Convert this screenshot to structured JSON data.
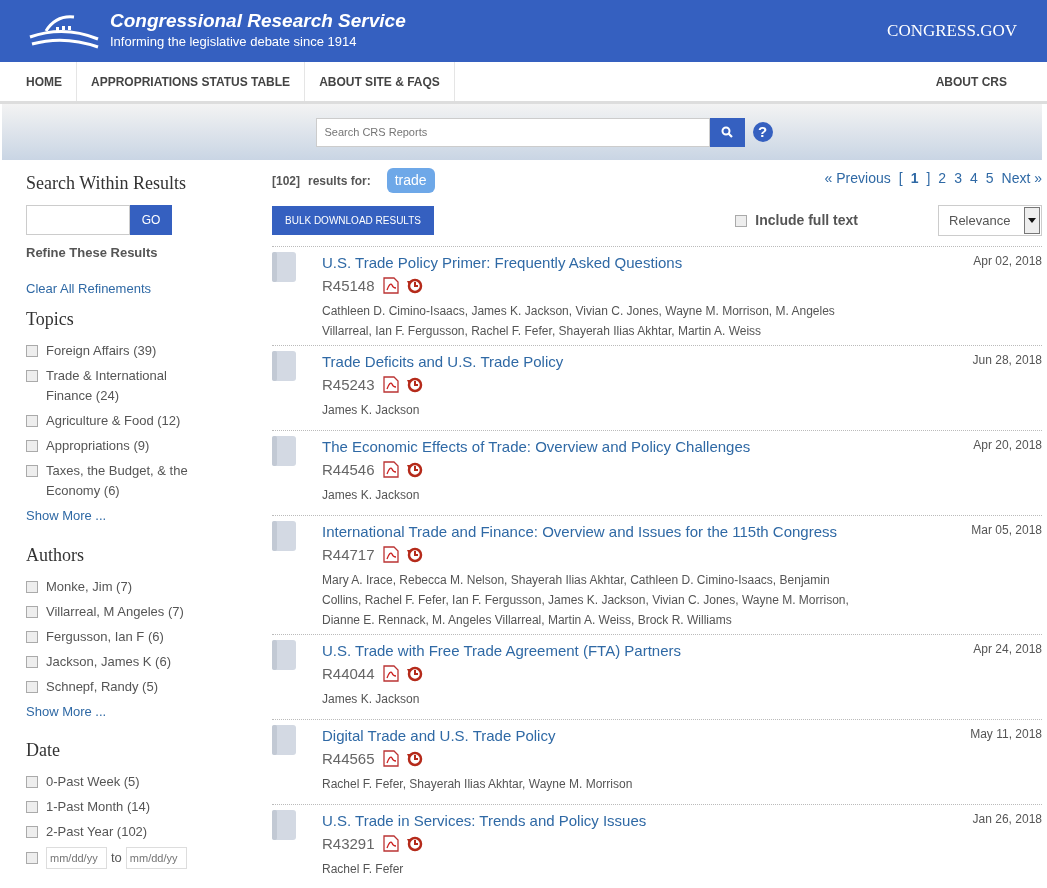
{
  "header": {
    "title": "Congressional Research Service",
    "tagline": "Informing the legislative debate since 1914",
    "partner": "CONGRESS.GOV"
  },
  "nav": {
    "left": [
      "HOME",
      "APPROPRIATIONS STATUS TABLE",
      "ABOUT SITE & FAQS"
    ],
    "right": [
      "ABOUT CRS"
    ]
  },
  "search": {
    "placeholder": "Search CRS Reports",
    "help": "?"
  },
  "sidebar": {
    "title": "Search Within Results",
    "go": "GO",
    "refine": "Refine These Results",
    "clear": "Clear All Refinements",
    "groups": [
      {
        "title": "Topics",
        "items": [
          {
            "label": "Foreign Affairs (39)",
            "checked": false
          },
          {
            "label": "Trade & International Finance (24)",
            "checked": false
          },
          {
            "label": "Agriculture & Food (12)",
            "checked": false
          },
          {
            "label": "Appropriations (9)",
            "checked": false
          },
          {
            "label": "Taxes, the Budget, & the Economy (6)",
            "checked": false
          }
        ],
        "more": "Show More ..."
      },
      {
        "title": "Authors",
        "items": [
          {
            "label": "Monke, Jim (7)",
            "checked": false
          },
          {
            "label": "Villarreal, M Angeles (7)",
            "checked": false
          },
          {
            "label": "Fergusson, Ian F (6)",
            "checked": false
          },
          {
            "label": "Jackson, James K (6)",
            "checked": false
          },
          {
            "label": "Schnepf, Randy (5)",
            "checked": false
          }
        ],
        "more": "Show More ..."
      },
      {
        "title": "Date",
        "items": [
          {
            "label": "0-Past Week (5)",
            "checked": false
          },
          {
            "label": "1-Past Month (14)",
            "checked": false
          },
          {
            "label": "2-Past Year (102)",
            "checked": false
          }
        ],
        "range": {
          "checked": false,
          "from_placeholder": "mm/dd/yy",
          "to": "to",
          "to_placeholder": "mm/dd/yy"
        }
      }
    ]
  },
  "results": {
    "count": "[102]",
    "label": "results for:",
    "query": "trade",
    "bulk": "BULK DOWNLOAD RESULTS",
    "fulltext": {
      "label": "Include full text",
      "checked": false
    },
    "sort": "Relevance",
    "pagination": {
      "previous": "« Previous",
      "open": "[",
      "close": "]",
      "next": "Next »",
      "pages": [
        {
          "label": "1",
          "selected": true
        },
        {
          "label": "2",
          "selected": false
        },
        {
          "label": "3",
          "selected": false
        },
        {
          "label": "4",
          "selected": false
        },
        {
          "label": "5",
          "selected": false
        }
      ]
    },
    "items": [
      {
        "title": "U.S. Trade Policy Primer: Frequently Asked Questions",
        "id": "R45148",
        "date": "Apr 02, 2018",
        "authors": "Cathleen D. Cimino-Isaacs,  James K. Jackson,  Vivian C. Jones,  Wayne M. Morrison,  M. Angeles Villarreal,  Ian F. Fergusson,  Rachel F. Fefer,  Shayerah Ilias Akhtar,  Martin A. Weiss"
      },
      {
        "title": "Trade Deficits and U.S. Trade Policy",
        "id": "R45243",
        "date": "Jun 28, 2018",
        "authors": "James K. Jackson"
      },
      {
        "title": "The Economic Effects of Trade: Overview and Policy Challenges",
        "id": "R44546",
        "date": "Apr 20, 2018",
        "authors": "James K. Jackson"
      },
      {
        "title": "International Trade and Finance: Overview and Issues for the 115th Congress",
        "id": "R44717",
        "date": "Mar 05, 2018",
        "authors": "Mary A. Irace,  Rebecca M. Nelson,  Shayerah Ilias Akhtar,  Cathleen D. Cimino-Isaacs,  Benjamin Collins,  Rachel F. Fefer,  Ian F. Fergusson,  James K. Jackson,  Vivian C. Jones,  Wayne M. Morrison,  Dianne E. Rennack,  M. Angeles Villarreal,  Martin A. Weiss,  Brock R. Williams"
      },
      {
        "title": "U.S. Trade with Free Trade Agreement (FTA) Partners",
        "id": "R44044",
        "date": "Apr 24, 2018",
        "authors": "James K. Jackson"
      },
      {
        "title": "Digital Trade and U.S. Trade Policy",
        "id": "R44565",
        "date": "May 11, 2018",
        "authors": "Rachel F. Fefer,  Shayerah Ilias Akhtar,  Wayne M. Morrison"
      },
      {
        "title": "U.S. Trade in Services: Trends and Policy Issues",
        "id": "R43291",
        "date": "Jan 26, 2018",
        "authors": "Rachel F. Fefer"
      }
    ]
  }
}
